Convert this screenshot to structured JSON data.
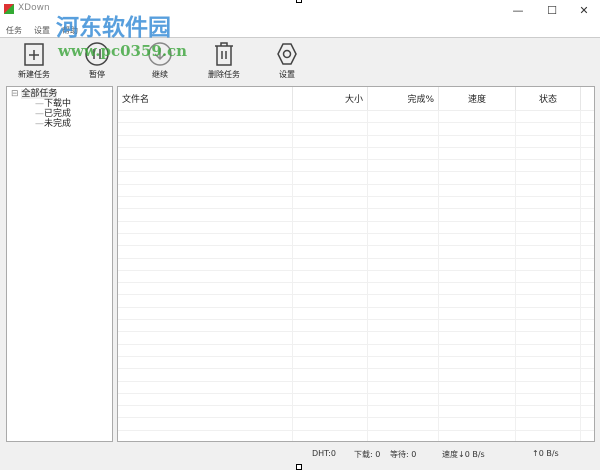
{
  "window": {
    "title": "XDown",
    "minimize": "—",
    "maximize": "☐",
    "close": "✕"
  },
  "menu": [
    "任务",
    "设置",
    "帮助"
  ],
  "toolbar": [
    {
      "label": "新建任务",
      "icon": "new-task-icon"
    },
    {
      "label": "暂停",
      "icon": "pause-icon"
    },
    {
      "label": "继续",
      "icon": "resume-icon"
    },
    {
      "label": "删除任务",
      "icon": "delete-icon"
    },
    {
      "label": "设置",
      "icon": "gear-icon"
    }
  ],
  "tree": {
    "root": "全部任务",
    "children": [
      "下载中",
      "已完成",
      "未完成"
    ]
  },
  "columns": [
    "文件名",
    "大小",
    "完成%",
    "速度",
    "状态"
  ],
  "status": {
    "dht": "DHT:0",
    "downloading": "下载: 0",
    "waiting": "等待: 0",
    "down_speed": "速度↓0 B/s",
    "up_speed": "↑0 B/s"
  },
  "watermark": {
    "name": "河东软件园",
    "url": "www.pc0359.cn"
  }
}
